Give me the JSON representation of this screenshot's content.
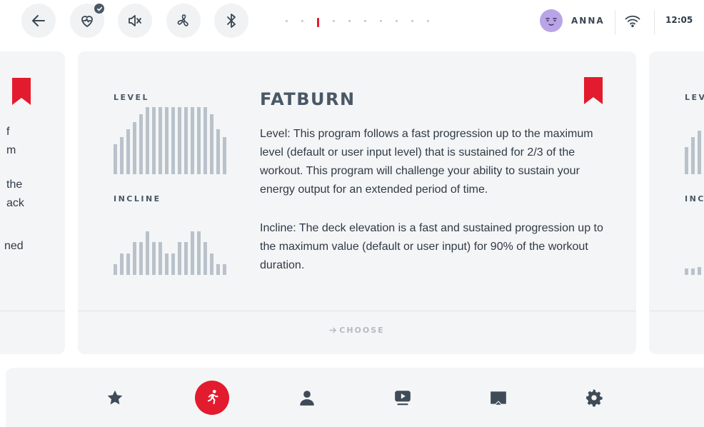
{
  "topbar": {
    "icons": [
      "back-arrow-icon",
      "heart-rate-icon",
      "sound-off-icon",
      "fan-icon",
      "bluetooth-icon"
    ],
    "pager": {
      "count": 10,
      "active_index": 2
    },
    "user": {
      "name": "ANNA"
    },
    "time": "12:05"
  },
  "colors": {
    "accent": "#e21b2e",
    "card_bg": "#f4f5f6",
    "bar": "#b9c2cb",
    "icon": "#4a5866"
  },
  "left_card": {
    "text_fragments": [
      "f",
      "m",
      "the",
      "ack",
      "ned"
    ]
  },
  "main_card": {
    "title": "FATBURN",
    "level_label": "LEVEL",
    "incline_label": "INCLINE",
    "level_profile": [
      4,
      5,
      6,
      7,
      8,
      9,
      9,
      9,
      9,
      9,
      9,
      9,
      9,
      9,
      9,
      8,
      6,
      5
    ],
    "incline_profile": [
      1,
      2,
      2,
      3,
      3,
      4,
      3,
      3,
      2,
      2,
      3,
      3,
      4,
      4,
      3,
      2,
      1,
      1
    ],
    "description_level": "Level: This program follows a fast progression up to the maximum level (default or user input level) that is sustained for 2/3 of the workout. This program will challenge your ability to sustain your energy output for an extended period of time.",
    "description_incline": "Incline: The deck elevation is a fast and sustained progression up to the maximum value (default or user input) for 90% of the workout duration.",
    "choose_label": "CHOOSE"
  },
  "right_card": {
    "level_label_partial": "LEV",
    "incline_label_partial": "INC"
  },
  "bottom_nav": {
    "items": [
      "star-icon",
      "running-icon",
      "user-icon",
      "video-icon",
      "cast-icon",
      "gear-icon"
    ],
    "active_index": 1
  }
}
